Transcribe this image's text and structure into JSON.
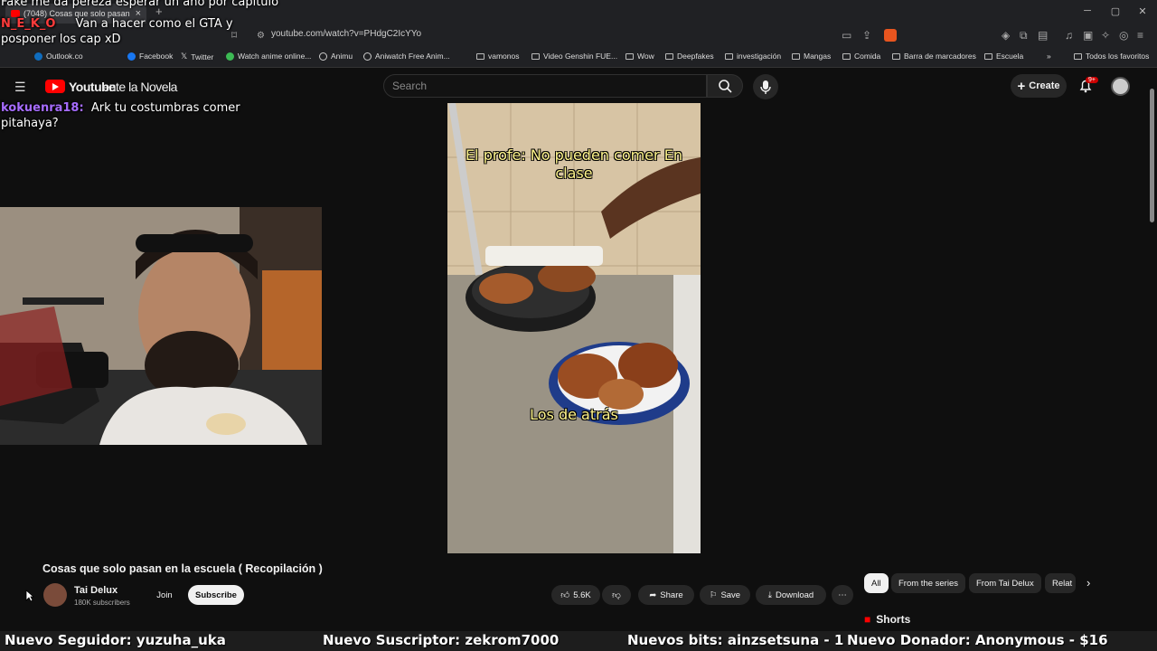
{
  "browser": {
    "tab_title": "(7048) Cosas que solo pasan",
    "url": "youtube.com/watch?v=PHdgC2IcYYo",
    "bookmarks": [
      {
        "label": "Outlook.co",
        "icon": "outlook-icon"
      },
      {
        "label": "Facebook",
        "icon": "facebook-icon"
      },
      {
        "label": "Twitter",
        "icon": "x-icon"
      },
      {
        "label": "Watch anime online...",
        "icon": "leaf-icon"
      },
      {
        "label": "Animu",
        "icon": "globe-icon"
      },
      {
        "label": "Aniwatch Free Anim...",
        "icon": "globe-icon"
      },
      {
        "label": "vamonos",
        "icon": "folder-icon"
      },
      {
        "label": "Video Genshin FUE...",
        "icon": "folder-icon"
      },
      {
        "label": "Wow",
        "icon": "folder-icon"
      },
      {
        "label": "Deepfakes",
        "icon": "folder-icon"
      },
      {
        "label": "investigación",
        "icon": "folder-icon"
      },
      {
        "label": "Mangas",
        "icon": "folder-icon"
      },
      {
        "label": "Comida",
        "icon": "folder-icon"
      },
      {
        "label": "Barra de marcadores",
        "icon": "folder-icon"
      },
      {
        "label": "Escuela",
        "icon": "folder-icon"
      }
    ],
    "all_bookmarks": "Todos los favoritos"
  },
  "youtube": {
    "search_placeholder": "Search",
    "create_label": "Create",
    "notification_badge": "9+"
  },
  "overlay": {
    "title_text": "Youtube",
    "stream_title": "ente la Novela",
    "chat": [
      {
        "text": "Fake me da pereza esperar un año por capítulo"
      },
      {
        "user": "N_E_K_O",
        "text": "Van a hacer como el GTA y posponer los cap xD"
      },
      {
        "user": "kokuenra18:",
        "text": "Ark tu costumbras comer pitahaya?"
      }
    ]
  },
  "video": {
    "caption_top": "El profe: No pueden comer En clase",
    "caption_bottom": "Los de atrás"
  },
  "watch": {
    "title": "Cosas que solo pasan en la escuela ( Recopilación )",
    "channel": "Tai Delux",
    "subscribers": "180K subscribers",
    "join": "Join",
    "subscribe": "Subscribe",
    "likes": "5.6K",
    "share": "Share",
    "save": "Save",
    "download": "Download"
  },
  "chips": [
    "All",
    "From the series",
    "From Tai Delux",
    "Relat"
  ],
  "shorts_label": "Shorts",
  "ticker": [
    "Nuevo Seguidor: yuzuha_uka",
    "Nuevo Suscriptor: zekrom7000",
    "Nuevos bits: ainzsetsuna - 1",
    "Nuevo Donador: Anonymous - $16"
  ],
  "colors": {
    "youtube_red": "#ff0000",
    "caption_yellow": "#fff58c",
    "chat_user": "#ff3b3b"
  }
}
